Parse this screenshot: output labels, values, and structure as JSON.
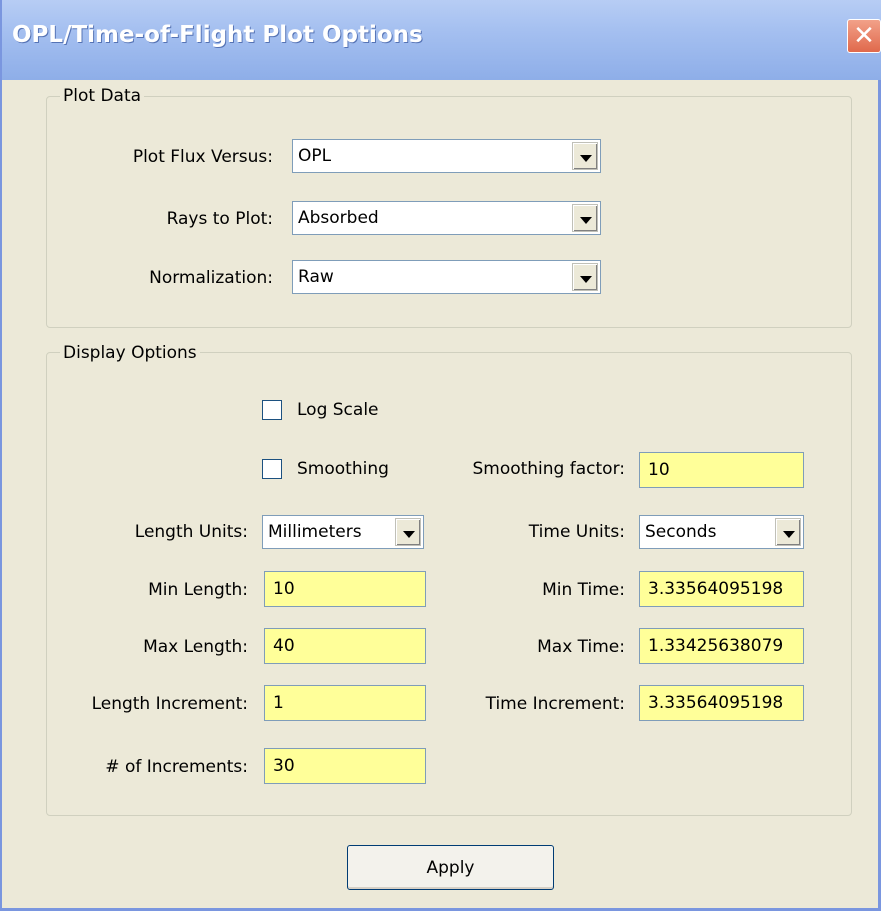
{
  "window": {
    "title": "OPL/Time-of-Flight Plot Options",
    "close_glyph": "✕"
  },
  "plot_data": {
    "group_label": "Plot Data",
    "plot_flux_versus": {
      "label": "Plot Flux Versus:",
      "value": "OPL"
    },
    "rays_to_plot": {
      "label": "Rays to Plot:",
      "value": "Absorbed"
    },
    "normalization": {
      "label": "Normalization:",
      "value": "Raw"
    }
  },
  "display_options": {
    "group_label": "Display Options",
    "log_scale": {
      "label": "Log Scale",
      "checked": false
    },
    "smoothing": {
      "label": "Smoothing",
      "checked": false
    },
    "smoothing_factor": {
      "label": "Smoothing factor:",
      "value": "10"
    },
    "length_units": {
      "label": "Length Units:",
      "value": "Millimeters"
    },
    "time_units": {
      "label": "Time Units:",
      "value": "Seconds"
    },
    "min_length": {
      "label": "Min Length:",
      "value": "10"
    },
    "min_time": {
      "label": "Min Time:",
      "value": "3.33564095198"
    },
    "max_length": {
      "label": "Max Length:",
      "value": "40"
    },
    "max_time": {
      "label": "Max Time:",
      "value": "1.33425638079"
    },
    "length_increment": {
      "label": "Length Increment:",
      "value": "1"
    },
    "time_increment": {
      "label": "Time Increment:",
      "value": "3.33564095198"
    },
    "num_increments": {
      "label": "# of Increments:",
      "value": "30"
    }
  },
  "apply_button": {
    "label": "Apply"
  },
  "colors": {
    "title_bar": "#a4bff0",
    "dialog_bg": "#ece9d8",
    "input_highlight": "#ffff99",
    "close_button": "#e0694c"
  }
}
